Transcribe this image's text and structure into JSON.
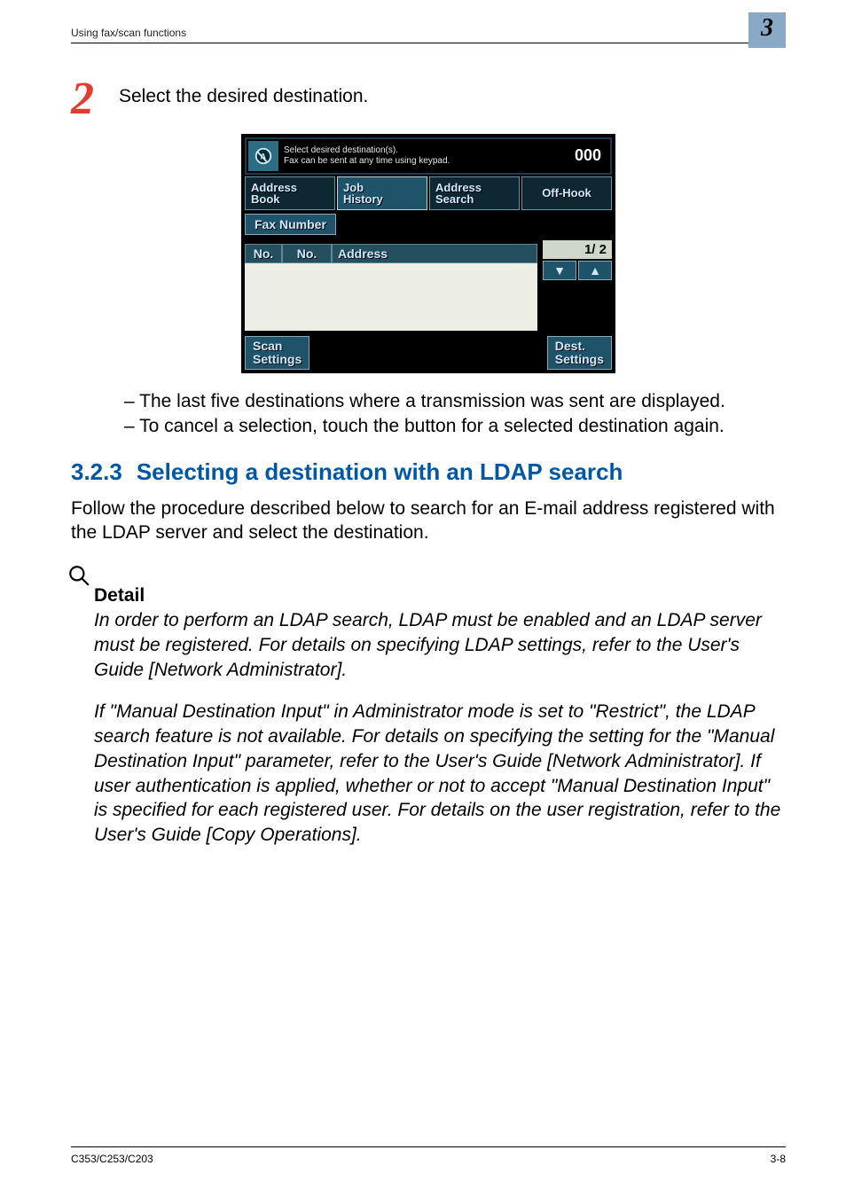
{
  "header": {
    "section": "Using fax/scan functions",
    "chapter": "3"
  },
  "step": {
    "number": "2",
    "text": "Select the desired destination."
  },
  "screen": {
    "msg1": "Select desired destination(s).",
    "msg2": "Fax can be sent at any time using keypad.",
    "counter": "000",
    "tabs": {
      "book": "Address\nBook",
      "history": "Job\nHistory",
      "search": "Address\nSearch"
    },
    "offhook": "Off-Hook",
    "faxnum": "Fax Number",
    "cols": {
      "c1": "No.",
      "c2": "No.",
      "c3": "Address"
    },
    "page": "1/  2",
    "scan": "Scan\nSettings",
    "dest": "Dest.\nSettings"
  },
  "notes": {
    "n1": "The last five destinations where a transmission was sent are displayed.",
    "n2": "To cancel a selection, touch the button for a selected destination again."
  },
  "section": {
    "num": "3.2.3",
    "title": "Selecting a destination with an LDAP search"
  },
  "intro": "Follow the procedure described below to search for an E-mail address registered with the LDAP server and select the destination.",
  "detail": {
    "label": "Detail",
    "p1": "In order to perform an LDAP search, LDAP must be enabled and an LDAP server must be registered. For details on specifying LDAP settings, refer to the User's Guide [Network Administrator].",
    "p2": "If \"Manual Destination Input\" in Administrator mode is set to \"Restrict\", the LDAP search feature is not available. For details on specifying the setting for the \"Manual Destination Input\" parameter, refer to the User's Guide [Network Administrator]. If user authentication is applied, whether or not to accept \"Manual Destination Input\" is specified for each registered user. For details on the user registration, refer to the User's Guide [Copy Operations]."
  },
  "footer": {
    "left": "C353/C253/C203",
    "right": "3-8"
  }
}
